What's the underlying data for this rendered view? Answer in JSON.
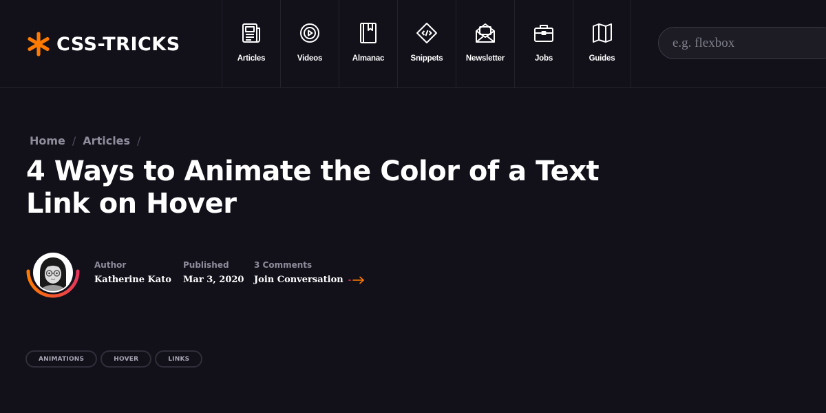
{
  "brand": {
    "name": "CSS-TRICKS",
    "accent": "#ff7a00"
  },
  "nav": [
    {
      "label": "Articles",
      "icon": "newspaper-icon"
    },
    {
      "label": "Videos",
      "icon": "play-circle-icon"
    },
    {
      "label": "Almanac",
      "icon": "book-icon"
    },
    {
      "label": "Snippets",
      "icon": "code-diamond-icon"
    },
    {
      "label": "Newsletter",
      "icon": "envelope-icon"
    },
    {
      "label": "Jobs",
      "icon": "briefcase-icon"
    },
    {
      "label": "Guides",
      "icon": "map-icon"
    }
  ],
  "search": {
    "placeholder": "e.g. flexbox",
    "value": ""
  },
  "breadcrumb": [
    {
      "label": "Home"
    },
    {
      "label": "Articles"
    }
  ],
  "article": {
    "title": "4 Ways to Animate the Color of a Text Link on Hover",
    "author_label": "Author",
    "author_name": "Katherine Kato",
    "published_label": "Published",
    "published_date": "Mar 3, 2020",
    "comments_label": "3 Comments",
    "join_label": "Join Conversation"
  },
  "tags": [
    "ANIMATIONS",
    "HOVER",
    "LINKS"
  ],
  "colors": {
    "background": "#12111a",
    "ring_start": "#ff7a00",
    "ring_end": "#e8345a"
  }
}
